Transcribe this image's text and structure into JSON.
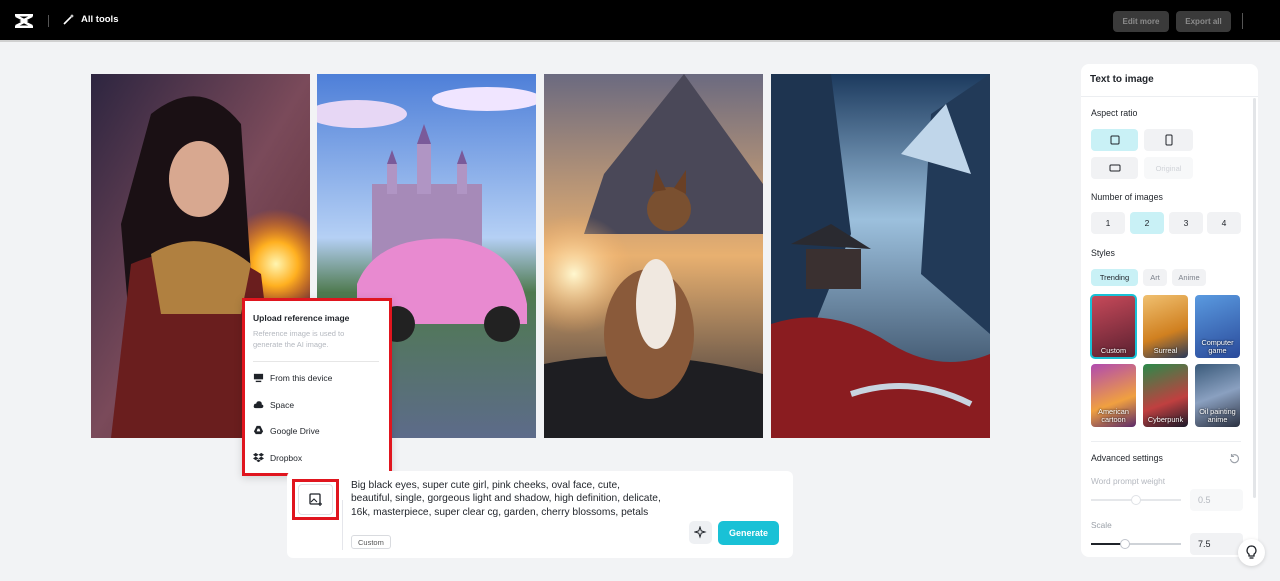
{
  "header": {
    "all_tools_label": "All tools",
    "edit_more_label": "Edit more",
    "export_all_label": "Export all"
  },
  "upload_menu": {
    "title": "Upload reference image",
    "description": "Reference image is used to generate the AI image.",
    "items": [
      "From this device",
      "Space",
      "Google Drive",
      "Dropbox"
    ]
  },
  "prompt": {
    "text": "Big black eyes, super cute girl, pink cheeks, oval face, cute, beautiful, single, gorgeous light and shadow, high definition, delicate, 16k, masterpiece, super clear cg, garden, cherry blossoms, petals",
    "style_tag": "Custom",
    "generate_label": "Generate"
  },
  "panel": {
    "title": "Text to image",
    "aspect_ratio_label": "Aspect ratio",
    "aspect_original_label": "Original",
    "num_images_label": "Number of images",
    "num_images_options": [
      "1",
      "2",
      "3",
      "4"
    ],
    "num_images_selected": "2",
    "styles_label": "Styles",
    "style_tabs": [
      "Trending",
      "Art",
      "Anime"
    ],
    "styles": [
      {
        "name": "Custom"
      },
      {
        "name": "Surreal"
      },
      {
        "name": "Computer game"
      },
      {
        "name": "American cartoon"
      },
      {
        "name": "Cyberpunk"
      },
      {
        "name": "Oil painting anime"
      }
    ],
    "advanced_label": "Advanced settings",
    "word_prompt_weight_label": "Word prompt weight",
    "word_prompt_weight_value": "0.5",
    "scale_label": "Scale",
    "scale_value": "7.5"
  },
  "colors": {
    "accent": "#19c1d6",
    "highlight_border": "#e0151e",
    "topbar": "#000000"
  }
}
